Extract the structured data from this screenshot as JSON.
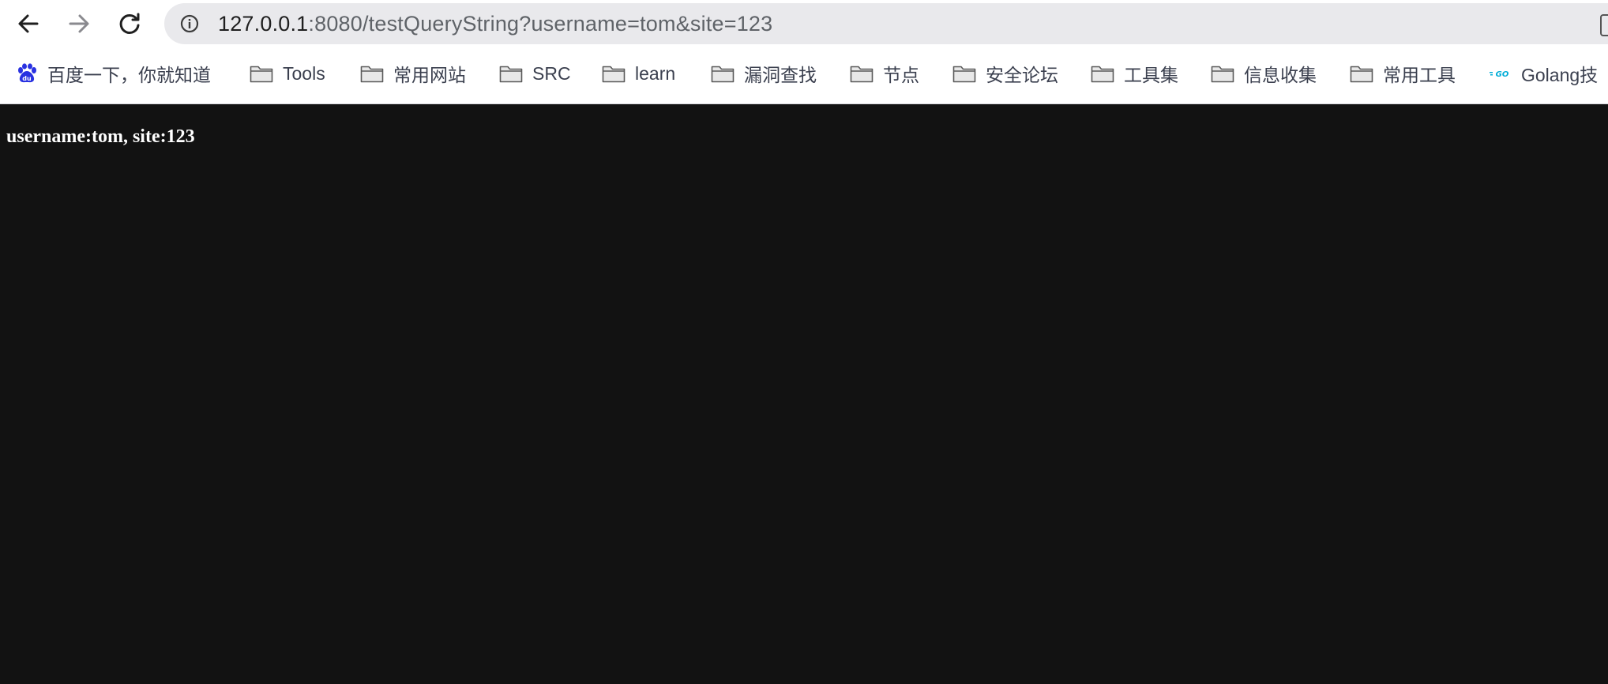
{
  "browser": {
    "address_bar": {
      "host": "127.0.0.1",
      "rest": ":8080/testQueryString?username=tom&site=123"
    },
    "bookmarks": [
      {
        "label": "百度一下，你就知道",
        "icon": "baidu-icon"
      },
      {
        "label": "Tools",
        "icon": "folder-icon"
      },
      {
        "label": "常用网站",
        "icon": "folder-icon"
      },
      {
        "label": "SRC",
        "icon": "folder-icon"
      },
      {
        "label": "learn",
        "icon": "folder-icon"
      },
      {
        "label": "漏洞查找",
        "icon": "folder-icon"
      },
      {
        "label": "节点",
        "icon": "folder-icon"
      },
      {
        "label": "安全论坛",
        "icon": "folder-icon"
      },
      {
        "label": "工具集",
        "icon": "folder-icon"
      },
      {
        "label": "信息收集",
        "icon": "folder-icon"
      },
      {
        "label": "常用工具",
        "icon": "folder-icon"
      },
      {
        "label": "Golang技",
        "icon": "golang-icon"
      }
    ]
  },
  "page": {
    "body_text": "username:tom, site:123"
  },
  "colors": {
    "page_background": "#121212",
    "page_text": "#ffffff",
    "omnibox_background": "#e9e9ec",
    "bookmark_text": "#3a3f4e",
    "baidu_blue": "#2932e1",
    "golang_cyan": "#00acd7"
  }
}
